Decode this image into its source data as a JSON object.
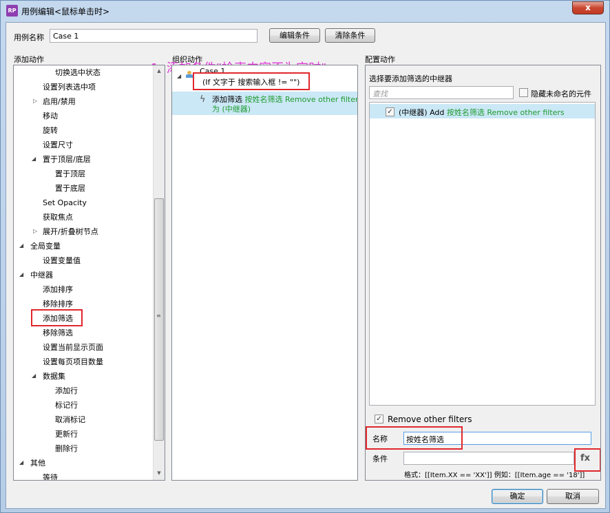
{
  "window": {
    "title": "用例编辑<鼠标单击时>",
    "app_icon": "RP",
    "close": "x"
  },
  "case_name": {
    "label": "用例名称",
    "value": "Case 1"
  },
  "buttons": {
    "edit_condition": "编辑条件",
    "clear_condition": "清除条件",
    "ok": "确定",
    "cancel": "取消"
  },
  "sections": {
    "add_action": "添加动作",
    "organize_action": "组织动作",
    "configure_action": "配置动作"
  },
  "annotation": "1, 添加条件\"检索内容不为空时\"",
  "tree_items": [
    "切换选中状态",
    "设置列表选中项",
    "启用/禁用",
    "移动",
    "旋转",
    "设置尺寸",
    "置于顶层/底层",
    "置于顶层",
    "置于底层",
    "Set Opacity",
    "获取焦点",
    "展开/折叠树节点",
    "全局变量",
    "设置变量值",
    "中继器",
    "添加排序",
    "移除排序",
    "添加筛选",
    "移除筛选",
    "设置当前显示页面",
    "设置每页项目数量",
    "数据集",
    "添加行",
    "标记行",
    "取消标记",
    "更新行",
    "删除行",
    "其他",
    "等待"
  ],
  "organize": {
    "case_label": "Case 1",
    "condition": "(If 文字于 搜索输入框 != \"\")",
    "action_prefix": "添加筛选",
    "action_green": "按姓名筛选 Remove other filters",
    "action_green2": "为 (中继器)"
  },
  "configure": {
    "select_label": "选择要添加筛选的中继器",
    "search_placeholder": "查找",
    "hide_unnamed": "隐藏未命名的元件",
    "repeater_prefix": "(中继器) Add",
    "repeater_green": "按姓名筛选 Remove other filters",
    "remove_other_filters": "Remove other filters",
    "name_label": "名称",
    "name_value": "按姓名筛选",
    "condition_label": "条件",
    "condition_value": "",
    "fx": "fx",
    "format_hint": "格式：[[Item.XX == 'XX']] 例如：[[Item.age == '18']]"
  },
  "colors": {
    "annotation": "#e135d9",
    "highlight_red": "#e0262b",
    "green_text": "#1f9a2e",
    "selection": "#cbe8f6"
  }
}
